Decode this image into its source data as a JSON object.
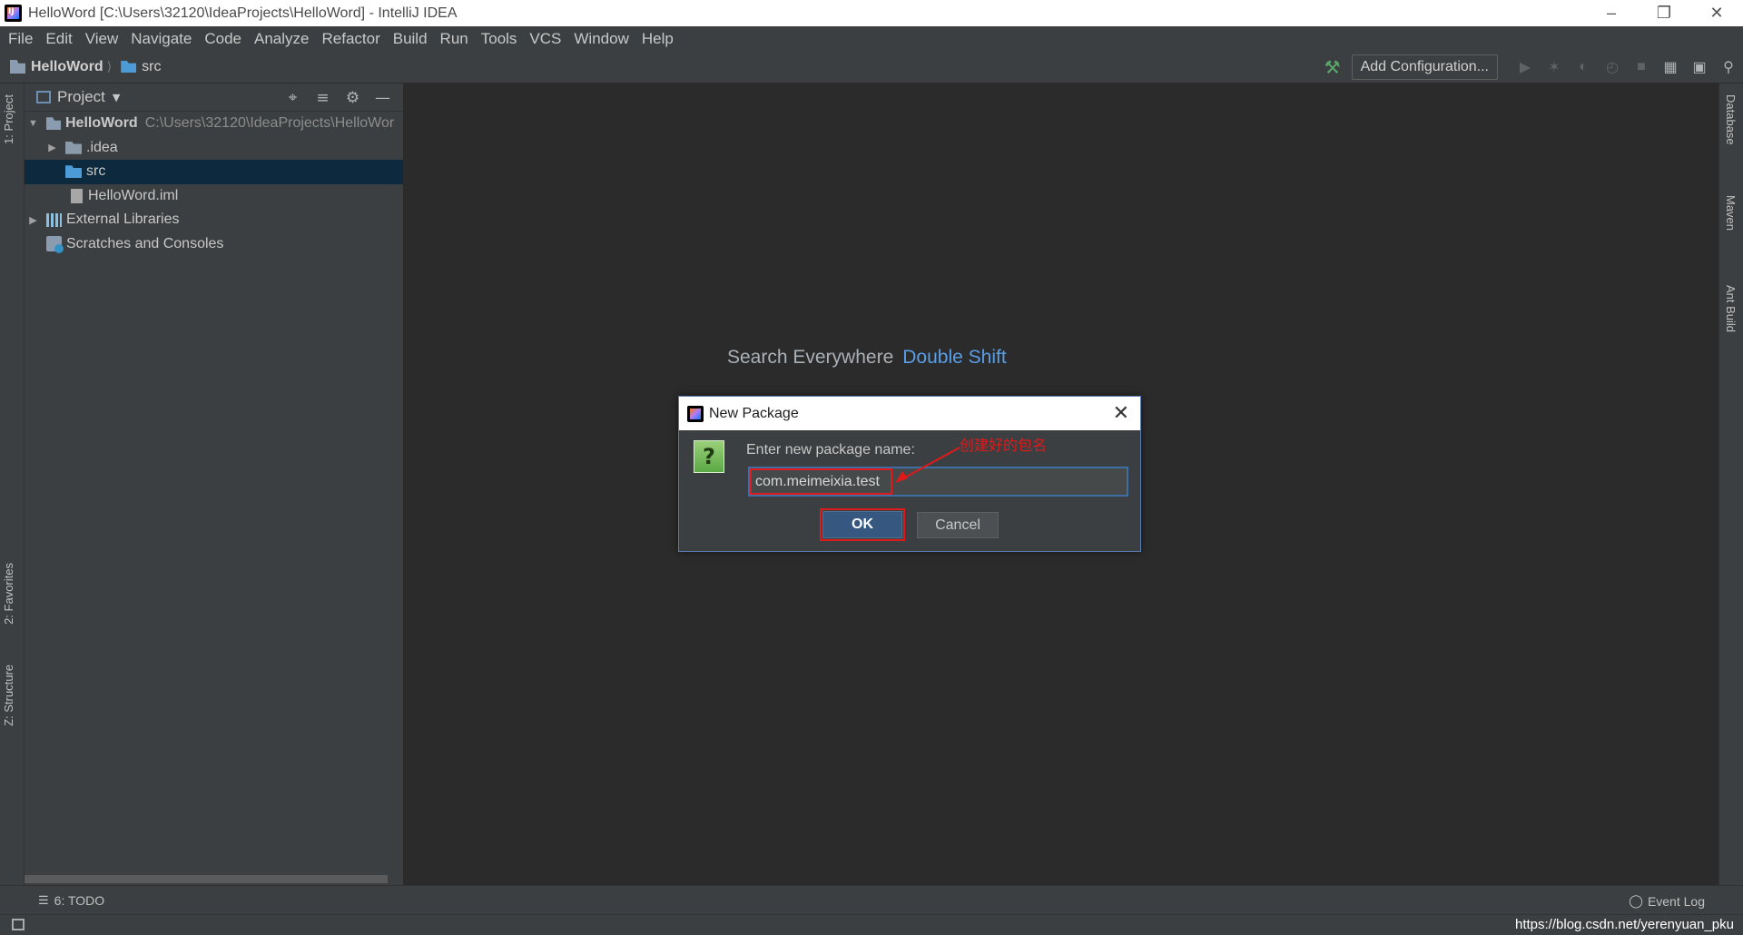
{
  "window": {
    "title": "HelloWord [C:\\Users\\32120\\IdeaProjects\\HelloWord] - IntelliJ IDEA"
  },
  "menu": [
    "File",
    "Edit",
    "View",
    "Navigate",
    "Code",
    "Analyze",
    "Refactor",
    "Build",
    "Run",
    "Tools",
    "VCS",
    "Window",
    "Help"
  ],
  "breadcrumb": {
    "project": "HelloWord",
    "folder": "src"
  },
  "toolbar": {
    "add_config_label": "Add Configuration..."
  },
  "left_tabs": {
    "project": "1: Project",
    "favorites": "2: Favorites",
    "structure": "Z: Structure"
  },
  "right_tabs": {
    "database": "Database",
    "maven": "Maven",
    "ant": "Ant Build"
  },
  "project_panel": {
    "title": "Project",
    "tree": [
      {
        "label": "HelloWord",
        "path": "C:\\Users\\32120\\IdeaProjects\\HelloWor"
      },
      {
        "label": ".idea"
      },
      {
        "label": "src"
      },
      {
        "label": "HelloWord.iml"
      },
      {
        "label": "External Libraries"
      },
      {
        "label": "Scratches and Consoles"
      }
    ]
  },
  "editor": {
    "hint_label": "Search Everywhere",
    "hint_key": "Double Shift"
  },
  "dialog": {
    "title": "New Package",
    "prompt": "Enter new package name:",
    "value": "com.meimeixia.test",
    "ok_label": "OK",
    "cancel_label": "Cancel"
  },
  "annotation": {
    "text": "创建好的包名",
    "color": "#e01a1a"
  },
  "bottom": {
    "todo_label": "6: TODO",
    "event_log_label": "Event Log"
  },
  "watermark": "https://blog.csdn.net/yerenyuan_pku"
}
